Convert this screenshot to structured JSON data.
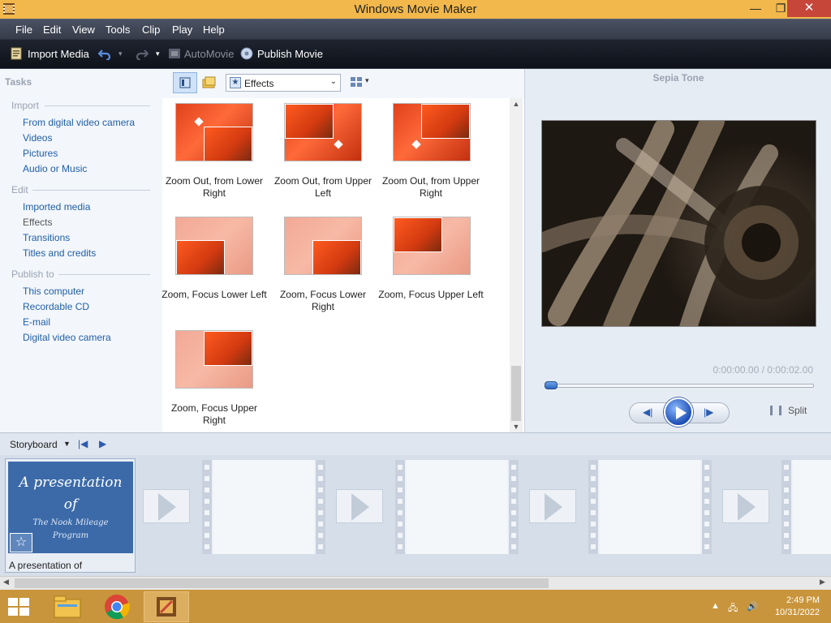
{
  "window": {
    "title": "Windows Movie Maker",
    "min_glyph": "—",
    "max_glyph": "❐",
    "close_glyph": "✕"
  },
  "menu": [
    "File",
    "Edit",
    "View",
    "Tools",
    "Clip",
    "Play",
    "Help"
  ],
  "toolbar": {
    "import_label": "Import Media",
    "automovie_label": "AutoMovie",
    "publish_label": "Publish Movie"
  },
  "tasks": {
    "header": "Tasks",
    "import": {
      "title": "Import",
      "items": [
        "From digital video camera",
        "Videos",
        "Pictures",
        "Audio or Music"
      ]
    },
    "edit": {
      "title": "Edit",
      "items": [
        "Imported media",
        "Effects",
        "Transitions",
        "Titles and credits"
      ]
    },
    "publish": {
      "title": "Publish to",
      "items": [
        "This computer",
        "Recordable CD",
        "E-mail",
        "Digital video camera"
      ]
    }
  },
  "effects": {
    "dropdown_value": "Effects",
    "items": [
      {
        "caption": "Zoom Out, from Lower Right"
      },
      {
        "caption": "Zoom Out, from Upper Left"
      },
      {
        "caption": "Zoom Out, from Upper Right"
      },
      {
        "caption": "Zoom, Focus Lower Left"
      },
      {
        "caption": "Zoom, Focus Lower Right"
      },
      {
        "caption": "Zoom, Focus Upper Left"
      },
      {
        "caption": "Zoom, Focus Upper Right"
      }
    ]
  },
  "preview": {
    "title": "Sepia Tone",
    "time": "0:00:00.00 / 0:00:02.00",
    "split_label": "Split",
    "progress": 0
  },
  "storyboard": {
    "label": "Storyboard",
    "clip1": {
      "line1": "A presentation",
      "line2": "of",
      "line3": "The Nook Mileage",
      "line4": "Program",
      "label": "A presentation of"
    }
  },
  "taskbar": {
    "time": "2:49 PM",
    "date": "10/31/2022"
  },
  "colors": {
    "titlebar": "#f2b84b",
    "close": "#c7463a",
    "taskbar": "#c9953c",
    "link": "#1f5fa8",
    "slide": "#3c6aa8"
  }
}
